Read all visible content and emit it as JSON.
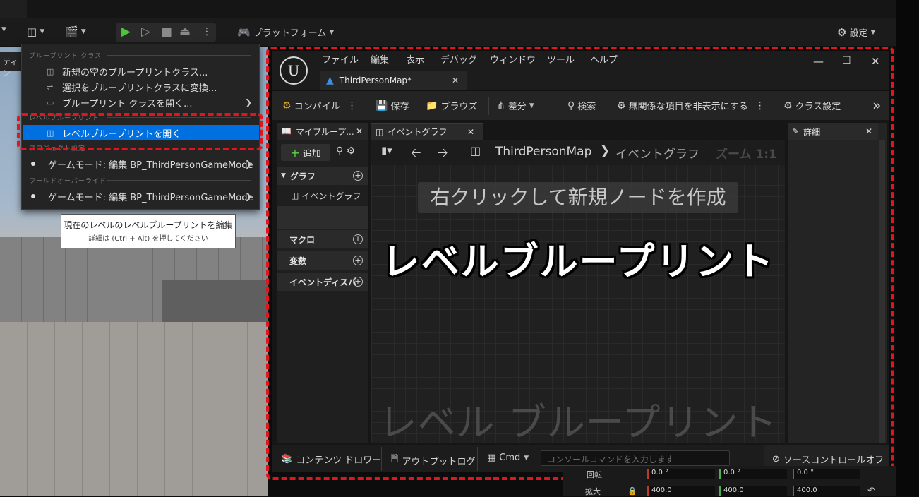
{
  "editor": {
    "toolbar": {
      "platform_label": "プラットフォーム",
      "settings_label": "設定"
    },
    "viewport_tab": "ティン"
  },
  "menu": {
    "section_blueprint_class": "ブループリント クラス",
    "items_top": [
      {
        "label": "新規の空のブループリントクラス..."
      },
      {
        "label": "選択をブループリントクラスに変換..."
      },
      {
        "label": "ブループリント クラスを開く..."
      }
    ],
    "section_level_blueprint": "レベルブループリント",
    "open_level_bp": "レベルブループリントを開く",
    "section_project_settings": "プロジェクト設定",
    "gamemode_project": "ゲームモード: 編集 BP_ThirdPersonGameMode",
    "section_world_override": "ワールドオーバーライド",
    "gamemode_world": "ゲームモード: 編集 BP_ThirdPersonGameMode"
  },
  "tooltip": {
    "line1": "現在のレベルのレベルブループリントを編集",
    "line2": "詳細は (Ctrl + Alt) を押してください"
  },
  "bp_window": {
    "menubar": [
      "ファイル",
      "編集",
      "表示",
      "デバッグ",
      "ウィンドウ",
      "ツール",
      "ヘルプ"
    ],
    "doc_tab": "ThirdPersonMap*",
    "toolbar": {
      "compile": "コンパイル",
      "save": "保存",
      "browse": "ブラウズ",
      "diff": "差分",
      "search": "検索",
      "hide_unrelated": "無関係な項目を非表示にする",
      "class_settings": "クラス設定"
    },
    "my_blueprint_tab": "マイブループ...",
    "add_button": "追加",
    "categories": {
      "graph": "グラフ",
      "event_graph_item": "イベントグラフ",
      "macro": "マクロ",
      "variables": "変数",
      "event_dispatchers": "イベントディスパ"
    },
    "graph_tab": "イベントグラフ",
    "breadcrumb_map": "ThirdPersonMap",
    "breadcrumb_graph": "イベントグラフ",
    "zoom": "ズーム 1:1",
    "hint": "右クリックして新規ノードを作成",
    "overlay_title": "レベルブループリント",
    "watermark": "レベル ブループリント",
    "details_tab": "詳細",
    "status": {
      "content_drawer": "コンテンツ ドロワー",
      "output_log": "アウトプットログ",
      "cmd": "Cmd",
      "console_placeholder": "コンソールコマンドを入力します",
      "source_control": "ソースコントロールオフ"
    }
  },
  "peek": {
    "rotation_label": "回転",
    "scale_label": "拡大",
    "rotation": [
      "0.0 °",
      "0.0 °",
      "0.0 °"
    ],
    "scale": [
      "400.0",
      "400.0",
      "400.0"
    ]
  },
  "colors": {
    "highlight_red": "#e0161e",
    "selection_blue": "#0070e0",
    "add_green": "#5fcf4a",
    "play_green": "#4ec43c"
  }
}
